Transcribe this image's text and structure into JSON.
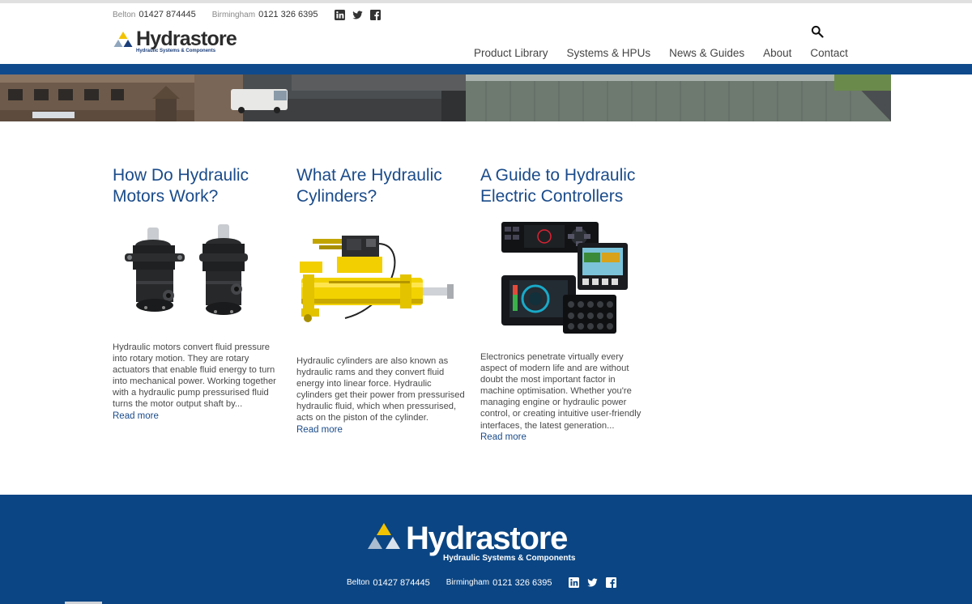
{
  "topbar": {
    "belton_city": "Belton",
    "belton_phone": "01427 874445",
    "birmingham_city": "Birmingham",
    "birmingham_phone": "0121 326 6395",
    "social": [
      "linkedin-icon",
      "twitter-icon",
      "facebook-icon"
    ]
  },
  "logo": {
    "brand": "Hydrastore",
    "tagline": "Hydraulic Systems & Components"
  },
  "nav": {
    "items": [
      "Product Library",
      "Systems & HPUs",
      "News & Guides",
      "About",
      "Contact"
    ]
  },
  "articles": [
    {
      "title": "How Do Hydraulic Motors Work?",
      "excerpt": "Hydraulic motors convert fluid pressure into rotary motion. They are rotary actuators that enable fluid energy to turn into mechanical power. Working together with a hydraulic pump pressurised fluid turns the motor output shaft by...",
      "read_more": "Read more"
    },
    {
      "title": "What Are Hydraulic Cylinders?",
      "excerpt": "Hydraulic cylinders are also known as hydraulic rams and they convert fluid energy into linear force. Hydraulic cylinders get their power from pressurised hydraulic fluid, which when pressurised, acts on the piston of the cylinder.",
      "read_more": "Read more"
    },
    {
      "title": "A Guide to Hydraulic Electric Controllers",
      "excerpt": "Electronics penetrate virtually every aspect of modern life and are without doubt the most important factor in machine optimisation. Whether you're managing engine or hydraulic power control, or creating intuitive user-friendly interfaces, the latest generation...",
      "read_more": "Read more"
    }
  ],
  "footer": {
    "brand": "Hydrastore",
    "tagline": "Hydraulic Systems & Components",
    "belton_city": "Belton",
    "belton_phone": "01427 874445",
    "birmingham_city": "Birmingham",
    "birmingham_phone": "0121 326 6395"
  },
  "colors": {
    "brand_blue": "#0f4a8c",
    "footer_blue": "#0b4583",
    "link_blue": "#1a4b8a",
    "logo_yellow": "#f2c200",
    "logo_steel": "#8fa6bd"
  }
}
